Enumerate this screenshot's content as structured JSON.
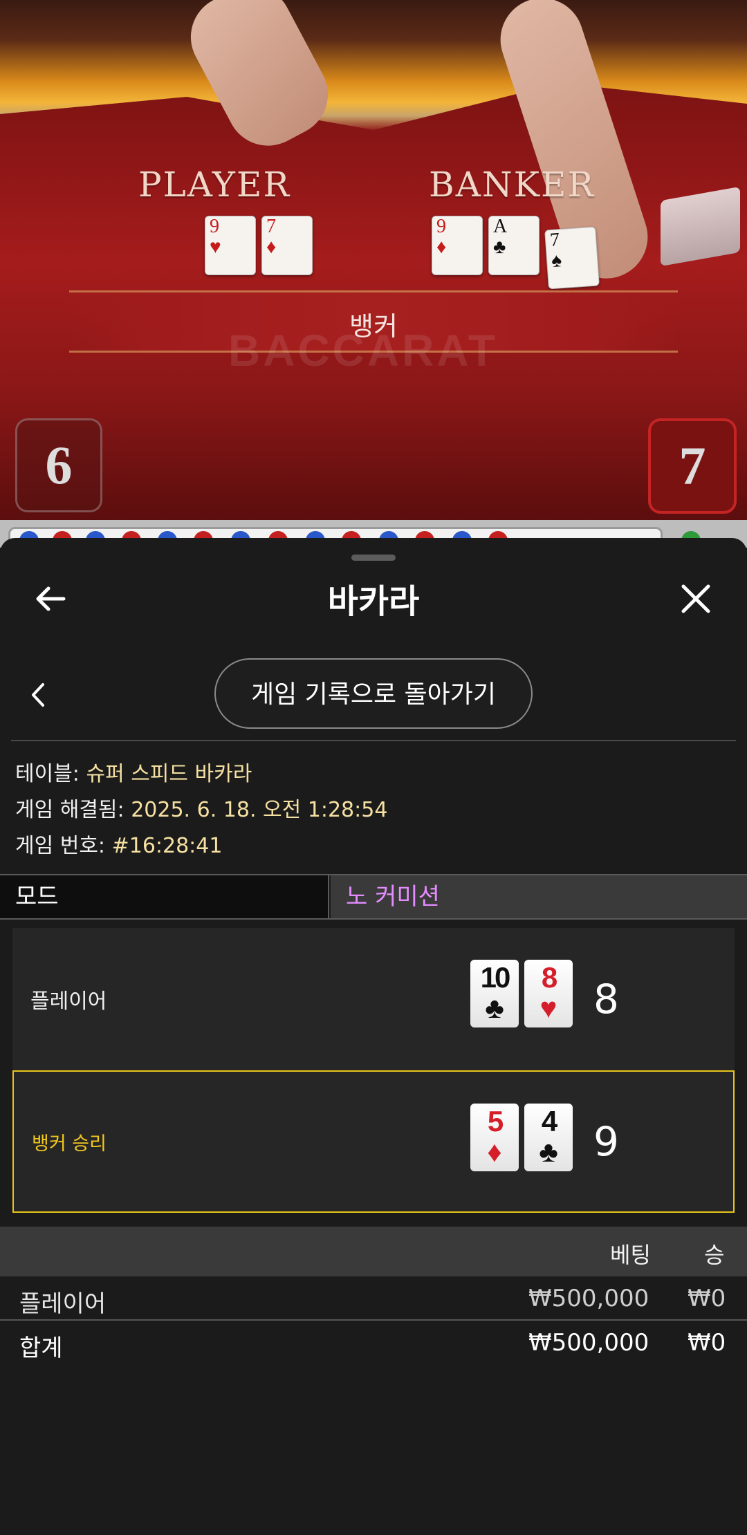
{
  "video": {
    "player_label": "PLAYER",
    "banker_label": "BANKER",
    "result_text": "뱅커",
    "watermark": "BACCARAT",
    "player_score": "6",
    "banker_score": "7",
    "player_cards": [
      {
        "rank": "9",
        "suit": "♥",
        "color": "#c51b1b"
      },
      {
        "rank": "7",
        "suit": "♦",
        "color": "#c51b1b"
      }
    ],
    "banker_cards": [
      {
        "rank": "9",
        "suit": "♦",
        "color": "#c51b1b"
      },
      {
        "rank": "A",
        "suit": "♣",
        "color": "#111111"
      },
      {
        "rank": "7",
        "suit": "♠",
        "color": "#111111"
      }
    ]
  },
  "header": {
    "title": "바카라",
    "back_icon": "arrow-left-icon",
    "close_icon": "close-icon"
  },
  "history_button": "게임 기록으로 돌아가기",
  "info": {
    "table_label": "테이블:",
    "table_value": "슈퍼 스피드 바카라",
    "resolved_label": "게임 해결됨:",
    "resolved_value": "2025. 6. 18. 오전 1:28:54",
    "number_label": "게임 번호:",
    "number_value": "#16:28:41"
  },
  "mode": {
    "label": "모드",
    "value": "노 커미션",
    "value_color": "#e48cff"
  },
  "hands": {
    "player": {
      "name": "플레이어",
      "cards": [
        {
          "rank": "10",
          "suit": "♣",
          "color": "black"
        },
        {
          "rank": "8",
          "suit": "♥",
          "color": "red"
        }
      ],
      "total": "8"
    },
    "banker": {
      "name": "뱅커 승리",
      "cards": [
        {
          "rank": "5",
          "suit": "♦",
          "color": "red"
        },
        {
          "rank": "4",
          "suit": "♣",
          "color": "black"
        }
      ],
      "total": "9",
      "highlight_color": "#e8c51a"
    }
  },
  "bets": {
    "col_bet": "베팅",
    "col_win": "승",
    "rows": [
      {
        "name": "플레이어",
        "bet": "₩500,000",
        "win": "₩0"
      }
    ],
    "total": {
      "name": "합계",
      "bet": "₩500,000",
      "win": "₩0"
    }
  }
}
